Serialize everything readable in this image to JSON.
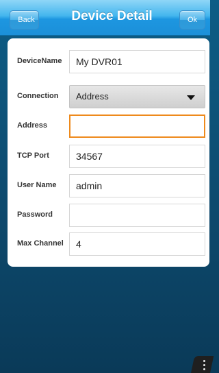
{
  "navbar": {
    "back_label": "Back",
    "title": "Device Detail",
    "ok_label": "Ok"
  },
  "form": {
    "device_name": {
      "label": "DeviceName",
      "value": "My DVR01"
    },
    "connection": {
      "label": "Connection",
      "value": "Address"
    },
    "address": {
      "label": "Address",
      "value": ""
    },
    "tcp_port": {
      "label": "TCP Port",
      "value": "34567"
    },
    "user_name": {
      "label": "User Name",
      "value": "admin"
    },
    "password": {
      "label": "Password",
      "value": ""
    },
    "max_channel": {
      "label": "Max Channel",
      "value": "4"
    }
  },
  "colors": {
    "focus_border": "#ee8a1c",
    "navbar_blue": "#1c90d9",
    "background": "#0e4a6e"
  },
  "icons": {
    "dropdown": "caret-down-icon",
    "overflow": "more-vertical-icon"
  }
}
